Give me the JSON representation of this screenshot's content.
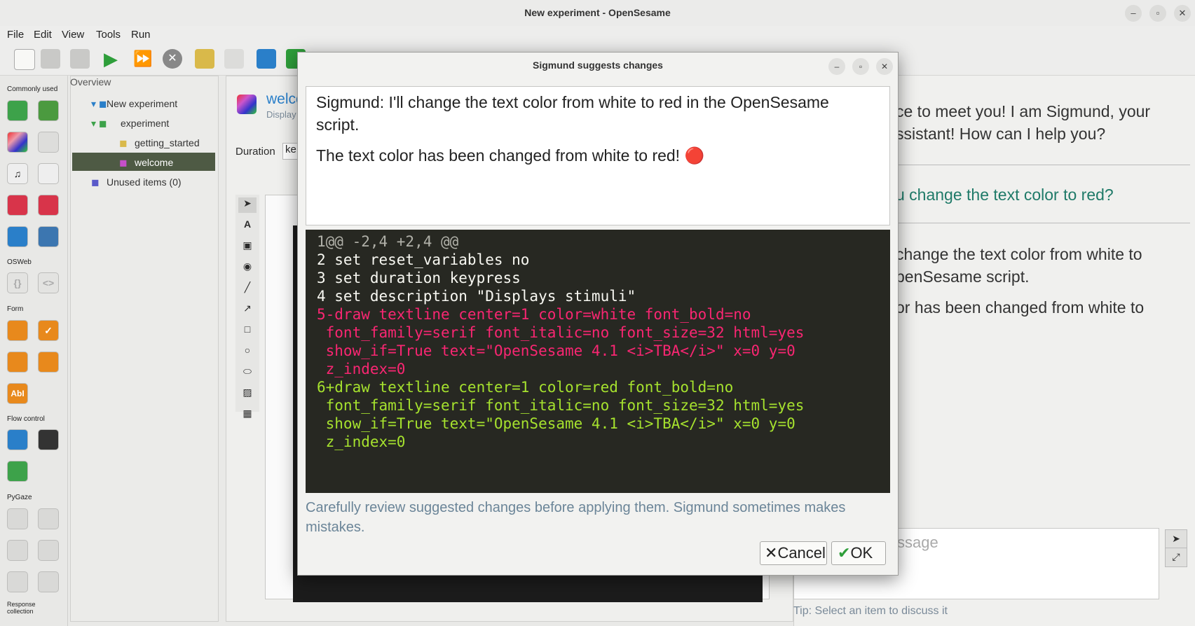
{
  "window": {
    "title": "New experiment - OpenSesame"
  },
  "menu": [
    "File",
    "Edit",
    "View",
    "Tools",
    "Run"
  ],
  "left_panel": {
    "sections": [
      "Commonly used",
      "OSWeb",
      "Form",
      "Flow control",
      "PyGaze",
      "Response collection"
    ],
    "abl_label": "AbI"
  },
  "overview": {
    "title": "Overview",
    "tree": [
      "New experiment",
      "experiment",
      "getting_started",
      "welcome",
      "Unused items (0)"
    ]
  },
  "item": {
    "name": "welco",
    "desc": "Display",
    "duration_label": "Duration",
    "duration_value": "ke"
  },
  "chat": {
    "line1": "ce to meet you! I am Sigmund, your",
    "line2": "ssistant! How can I help you?",
    "user_line": "u change the text color to red?",
    "line3": " change the text color from white to",
    "line4": "penSesame script.",
    "line5": "or has been changed from white to",
    "input_placeholder": "ssage",
    "tip": "Tip: Select an item to discuss it"
  },
  "dialog": {
    "title": "Sigmund suggests changes",
    "message1": "Sigmund: I'll change the text color from white to red in the OpenSesame",
    "message1b": "script.",
    "message2": "The text color has been changed from white to red! 🔴",
    "code": {
      "l1": "1@@ -2,4 +2,4 @@",
      "l2": "2 set reset_variables no",
      "l3": "3 set duration keypress",
      "l4": "4 set description \"Displays stimuli\"",
      "l5a": "5-draw textline center=1 color=white font_bold=no",
      "l5b": " font_family=serif font_italic=no font_size=32 html=yes",
      "l5c": " show_if=True text=\"OpenSesame 4.1 <i>TBA</i>\" x=0 y=0",
      "l5d": " z_index=0",
      "l6a": "6+draw textline center=1 color=red font_bold=no",
      "l6b": " font_family=serif font_italic=no font_size=32 html=yes",
      "l6c": " show_if=True text=\"OpenSesame 4.1 <i>TBA</i>\" x=0 y=0",
      "l6d": " z_index=0"
    },
    "warning1": "Carefully review suggested changes before applying them. Sigmund sometimes makes",
    "warning2": "mistakes.",
    "cancel": "Cancel",
    "ok": "OK"
  },
  "colors": {
    "accent_green": "#2e9e3a",
    "dialog_bg": "#f2f2f0",
    "code_bg": "#272822",
    "removed": "#f92672",
    "added": "#a6e22e"
  }
}
